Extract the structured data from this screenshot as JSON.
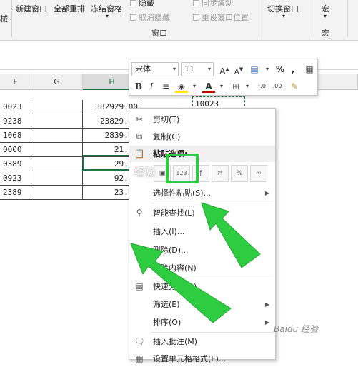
{
  "ribbon": {
    "left_cut": "械",
    "new_window": "新建窗口",
    "arrange_all": "全部重排",
    "freeze_panes": "冻结窗格",
    "hide": "隐藏",
    "unhide": "取消隐藏",
    "sync_scroll": "同步滚动",
    "reset_pos": "重设窗口位置",
    "switch_window": "切换窗口",
    "macro1": "宏",
    "macro2": "宏",
    "group_label": "窗口"
  },
  "columns": [
    "F",
    "G",
    "H"
  ],
  "rows": [
    {
      "f": "0023",
      "h": "382929.00"
    },
    {
      "f": "9238",
      "h": "23829.00"
    },
    {
      "f": "1068",
      "h": "2839.00"
    },
    {
      "f": "0000",
      "h": "21.00"
    },
    {
      "f": "0389",
      "h": "29.00"
    },
    {
      "f": "0923",
      "h": "92.00"
    },
    {
      "f": "2389",
      "h": "23.00"
    }
  ],
  "copied_cell": "10023",
  "mini_toolbar": {
    "font_name": "宋体",
    "font_size": "11",
    "grow_font": "A",
    "shrink_font": "A",
    "percent": "%",
    "comma": ",",
    "bold": "B",
    "italic": "I",
    "font_color_letter": "A",
    "dec_increase": "⁺.0",
    "dec_decrease": ".00"
  },
  "context_menu": {
    "cut": "剪切(T)",
    "copy": "复制(C)",
    "paste_options": "粘贴选项:",
    "paste_values_label": "123",
    "paste_special": "选择性粘贴(S)...",
    "smart_lookup": "智能查找(L)",
    "insert": "插入(I)...",
    "delete": "删除(D)...",
    "clear": "清除内容(N)",
    "quick_analysis": "快速分析(Q)",
    "filter": "筛选(E)",
    "sort": "排序(O)",
    "insert_comment": "插入批注(M)",
    "format_cells": "设置单元格格式(F)..."
  },
  "watermark": "经验",
  "baidu_mark": "Baidu 经验",
  "colors": {
    "excel_green": "#217346",
    "highlight_green": "#2ecc40",
    "font_red": "#c00000",
    "fill_yellow": "#ffe600"
  }
}
